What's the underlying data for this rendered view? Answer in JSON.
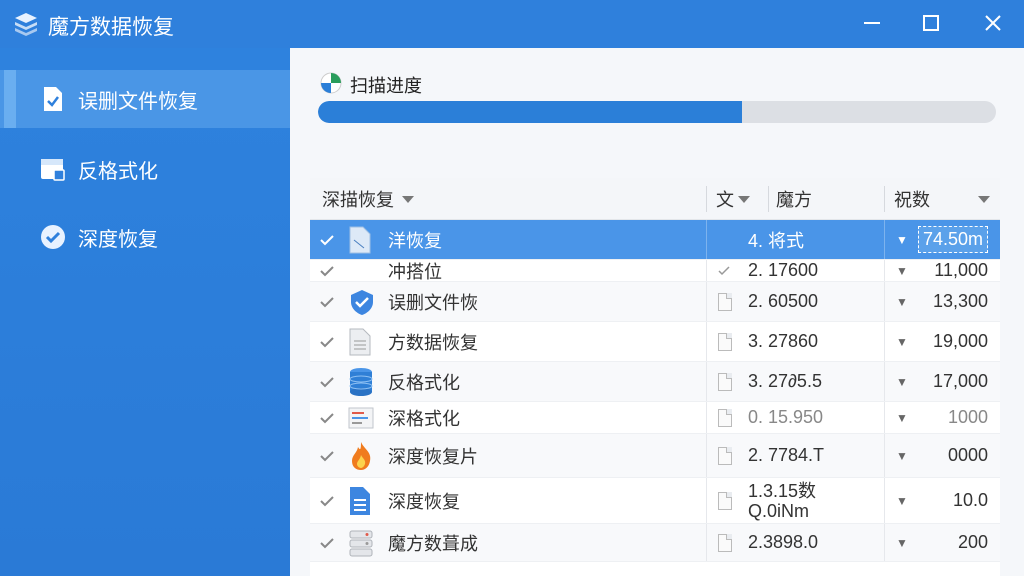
{
  "app": {
    "title": "魔方数据恢复"
  },
  "window_controls": {
    "minimize": "—",
    "maximize": "☐",
    "close": "✕"
  },
  "sidebar": {
    "items": [
      {
        "label": "误删文件恢复",
        "icon": "document-check-icon",
        "active": true
      },
      {
        "label": "反格式化",
        "icon": "drive-format-icon",
        "active": false
      },
      {
        "label": "深度恢复",
        "icon": "check-circle-icon",
        "active": false
      }
    ]
  },
  "scan": {
    "label": "扫描进度",
    "progress": 0.625
  },
  "table": {
    "headers": {
      "name": "深描恢复",
      "type": "文",
      "size": "魔方",
      "count": "祝数"
    },
    "rows": [
      {
        "name": "洋恢复",
        "size": "4. 将式",
        "count": "74.50m",
        "icon": "document-blue-icon",
        "selected": true
      },
      {
        "name": "冲搭位",
        "size": "2. 17600",
        "count": "11,000",
        "icon": "document-icon"
      },
      {
        "name": "误删文件恢",
        "size": "2. 60500",
        "count": "13,300",
        "icon": "shield-check-icon"
      },
      {
        "name": "方数据恢复",
        "size": "3. 27860",
        "count": "19,000",
        "icon": "text-file-icon"
      },
      {
        "name": "反格式化",
        "size": "3. 27∂5.5",
        "count": "17,000",
        "icon": "database-icon"
      },
      {
        "name": "深格式化",
        "size": "0. 15.950",
        "count": "1000",
        "icon": "spreadsheet-icon"
      },
      {
        "name": "深度恢复片",
        "size": "2. 7784.T",
        "count": "0000",
        "icon": "fire-icon"
      },
      {
        "name": "深度恢复",
        "size": "1.3.15数 Q.0iNm",
        "count": "10.0",
        "icon": "blue-document-icon"
      },
      {
        "name": "魔方数葺成",
        "size": "2.3898.0",
        "count": "200",
        "icon": "server-icon"
      }
    ]
  },
  "colors": {
    "accent": "#2f80dc",
    "selected_row": "#4a95e8",
    "progress": "#2b7fd8"
  }
}
